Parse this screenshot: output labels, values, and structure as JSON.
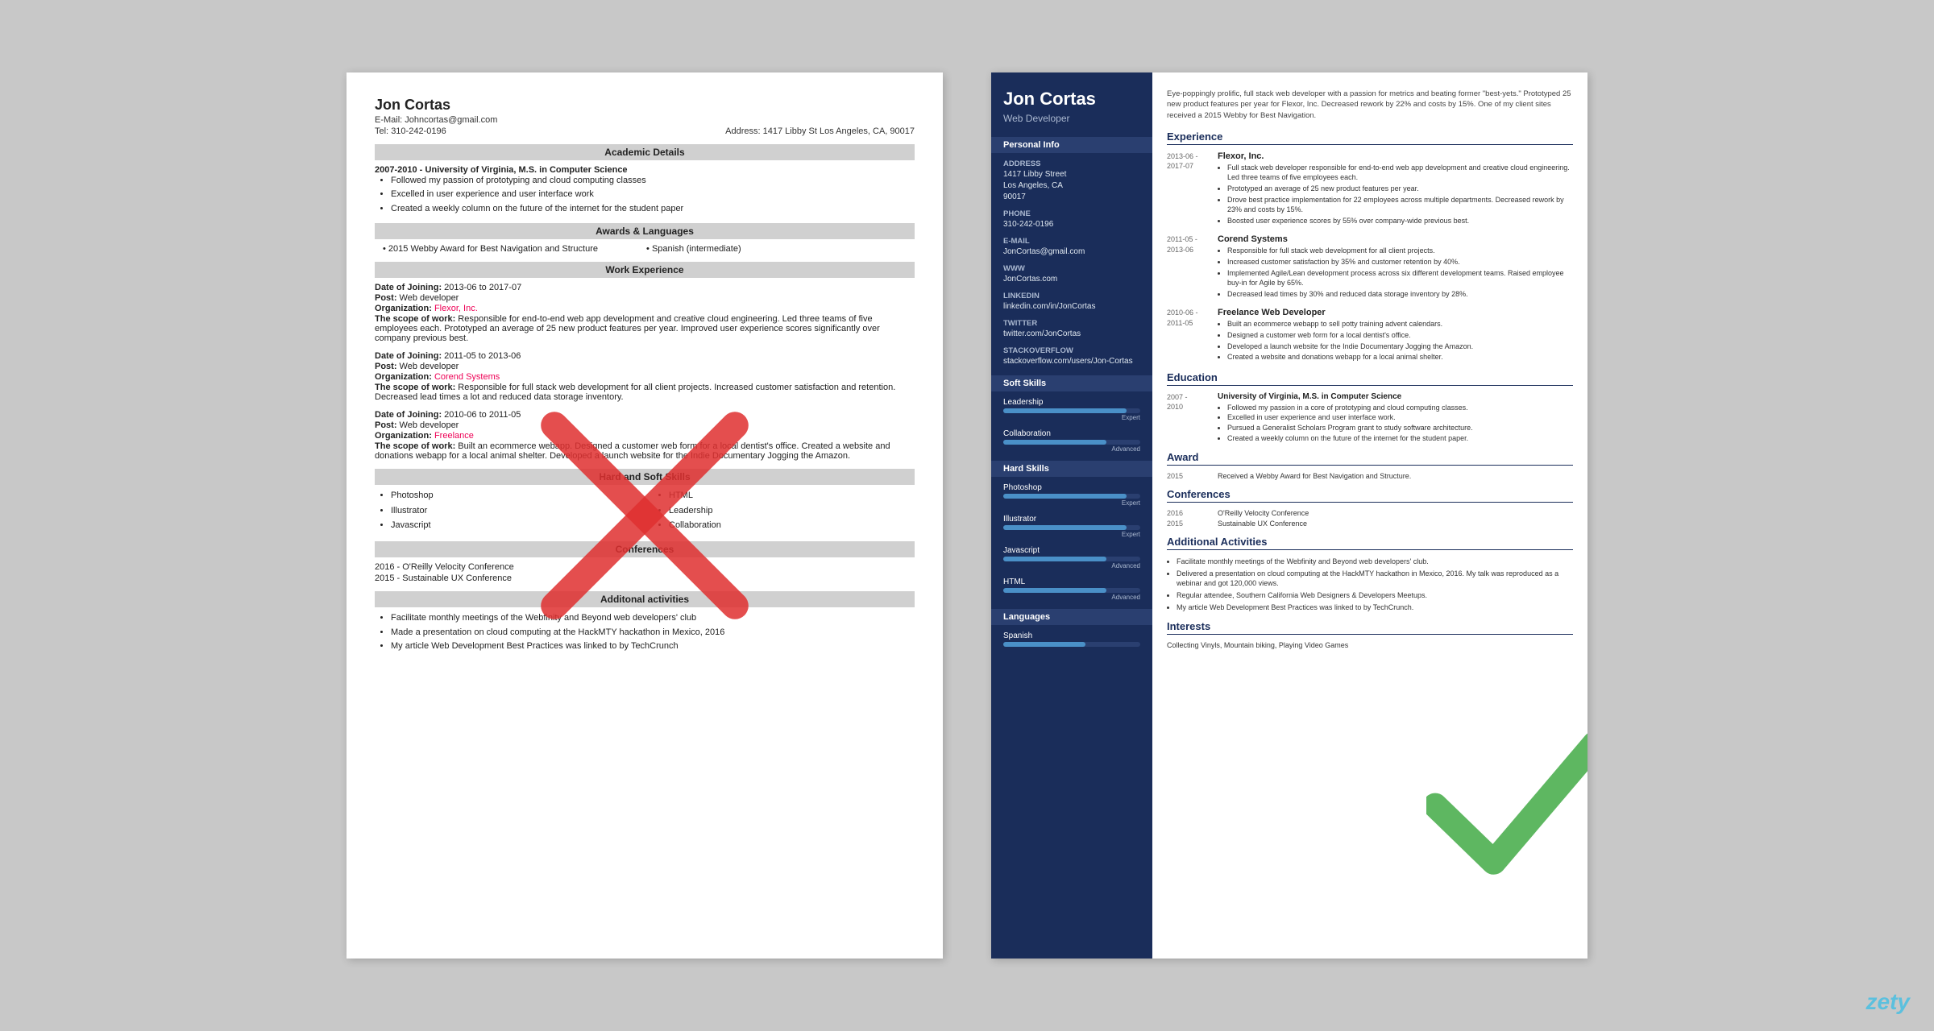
{
  "left_resume": {
    "name": "Jon Cortas",
    "email_label": "E-Mail:",
    "email": "Johncortas@gmail.com",
    "address_label": "Address:",
    "address": "1417 Libby St Los Angeles, CA, 90017",
    "tel_label": "Tel:",
    "tel": "310-242-0196",
    "academic_section": "Academic Details",
    "academic_years": "2007-2010 -",
    "academic_degree": "University of Virginia, M.S. in Computer Science",
    "academic_bullets": [
      "Followed my passion of prototyping and cloud computing classes",
      "Excelled in user experience and user interface work",
      "Created a weekly column on the future of the internet for the student paper"
    ],
    "awards_section": "Awards & Languages",
    "award_item": "2015 Webby Award for Best Navigation and Structure",
    "language_item": "Spanish (intermediate)",
    "work_section": "Work Experience",
    "jobs": [
      {
        "date_label": "Date of Joining:",
        "date": "2013-06 to 2017-07",
        "post_label": "Post:",
        "post": "Web developer",
        "org_label": "Organization:",
        "org": "Flexor, Inc.",
        "scope_label": "The scope of work:",
        "scope": "Responsible for end-to-end web app development and creative cloud engineering. Led three teams of five employees each. Prototyped an average of 25 new product features per year. Improved user experience scores significantly over company previous best."
      },
      {
        "date_label": "Date of Joining:",
        "date": "2011-05 to 2013-06",
        "post_label": "Post:",
        "post": "Web developer",
        "org_label": "Organization:",
        "org": "Corend Systems",
        "scope_label": "The scope of work:",
        "scope": "Responsible for full stack web development for all client projects. Increased customer satisfaction and retention. Decreased lead times a lot and reduced data storage inventory."
      },
      {
        "date_label": "Date of Joining:",
        "date": "2010-06 to 2011-05",
        "post_label": "Post:",
        "post": "Web developer",
        "org_label": "Organization:",
        "org": "Freelance",
        "scope_label": "The scope of work:",
        "scope": "Built an ecommerce webapp. Designed a customer web form for a local dentist's office. Created a website and donations webapp for a local animal shelter. Developed a launch website for the Indie Documentary Jogging the Amazon."
      }
    ],
    "skills_section": "Hard and Soft Skills",
    "skills": [
      "Photoshop",
      "Illustrator",
      "Javascript",
      "HTML",
      "Leadership",
      "Collaboration"
    ],
    "conferences_section": "Conferences",
    "conferences": [
      "2016 - O'Reilly Velocity Conference",
      "2015 - Sustainable UX Conference"
    ],
    "activities_section": "Additonal activities",
    "activities": [
      "Facilitate monthly meetings of the Webfinity and Beyond web developers' club",
      "Made a presentation on cloud computing at the HackMTY hackathon in Mexico, 2016",
      "My article Web Development Best Practices was linked to by TechCrunch"
    ]
  },
  "right_resume": {
    "name": "Jon Cortas",
    "title": "Web Developer",
    "summary": "Eye-poppingly prolific, full stack web developer with a passion for metrics and beating former \"best-yets.\" Prototyped 25 new product features per year for Flexor, Inc. Decreased rework by 22% and costs by 15%. One of my client sites received a 2015 Webby for Best Navigation.",
    "personal_info_section": "Personal Info",
    "address_label": "Address",
    "address": "1417 Libby Street\nLos Angeles, CA\n90017",
    "phone_label": "Phone",
    "phone": "310-242-0196",
    "email_label": "E-mail",
    "email": "JonCortas@gmail.com",
    "www_label": "WWW",
    "www": "JonCortas.com",
    "linkedin_label": "LinkedIn",
    "linkedin": "linkedin.com/in/JonCortas",
    "twitter_label": "Twitter",
    "twitter": "twitter.com/JonCortas",
    "stackoverflow_label": "StackOverflow",
    "stackoverflow": "stackoverflow.com/users/Jon-Cortas",
    "soft_skills_section": "Soft Skills",
    "soft_skills": [
      {
        "name": "Leadership",
        "level": 90,
        "badge": "Expert"
      },
      {
        "name": "Collaboration",
        "level": 75,
        "badge": "Advanced"
      }
    ],
    "hard_skills_section": "Hard Skills",
    "hard_skills": [
      {
        "name": "Photoshop",
        "level": 90,
        "badge": "Expert"
      },
      {
        "name": "Illustrator",
        "level": 90,
        "badge": "Expert"
      },
      {
        "name": "Javascript",
        "level": 75,
        "badge": "Advanced"
      },
      {
        "name": "HTML",
        "level": 75,
        "badge": "Advanced"
      }
    ],
    "languages_section": "Languages",
    "languages": [
      {
        "name": "Spanish",
        "level": 60
      }
    ],
    "experience_section": "Experience",
    "experience": [
      {
        "dates": "2013-06 -\n2017-07",
        "company": "Flexor, Inc.",
        "bullets": [
          "Full stack web developer responsible for end-to-end web app development and creative cloud engineering. Led three teams of five employees each.",
          "Prototyped an average of 25 new product features per year.",
          "Drove best practice implementation for 22 employees across multiple departments. Decreased rework by 23% and costs by 15%.",
          "Boosted user experience scores by 55% over company-wide previous best."
        ]
      },
      {
        "dates": "2011-05 -\n2013-06",
        "company": "Corend Systems",
        "bullets": [
          "Responsible for full stack web development for all client projects.",
          "Increased customer satisfaction by 35% and customer retention by 40%.",
          "Implemented Agile/Lean development process across six different development teams. Raised employee buy-in for Agile by 65%.",
          "Decreased lead times by 30% and reduced data storage inventory by 28%."
        ]
      },
      {
        "dates": "2010-06 -\n2011-05",
        "company": "Freelance Web Developer",
        "bullets": [
          "Built an ecommerce webapp to sell potty training advent calendars.",
          "Designed a customer web form for a local dentist's office.",
          "Developed a launch website for the Indie Documentary Jogging the Amazon.",
          "Created a website and donations webapp for a local animal shelter."
        ]
      }
    ],
    "education_section": "Education",
    "education": [
      {
        "dates": "2007 -\n2010",
        "title": "University of Virginia, M.S. in Computer Science",
        "bullets": [
          "Followed my passion in a core of prototyping and cloud computing classes.",
          "Excelled in user experience and user interface work.",
          "Pursued a Generalist Scholars Program grant to study software architecture.",
          "Created a weekly column on the future of the internet for the student paper."
        ]
      }
    ],
    "award_section": "Award",
    "award_year": "2015",
    "award_text": "Received a Webby Award for Best Navigation and Structure.",
    "conferences_section": "Conferences",
    "conferences": [
      {
        "year": "2016",
        "name": "O'Reilly Velocity Conference"
      },
      {
        "year": "2015",
        "name": "Sustainable UX Conference"
      }
    ],
    "activities_section": "Additional Activities",
    "activities": [
      "Facilitate monthly meetings of the Webfinity and Beyond web developers' club.",
      "Delivered a presentation on cloud computing at the HackMTY hackathon in Mexico, 2016. My talk was reproduced as a webinar and got 120,000 views.",
      "Regular attendee, Southern California Web Designers & Developers Meetups.",
      "My article Web Development Best Practices was linked to by TechCrunch."
    ],
    "interests_section": "Interests",
    "interests": "Collecting Vinyls, Mountain biking, Playing Video Games"
  },
  "watermark": "zety"
}
